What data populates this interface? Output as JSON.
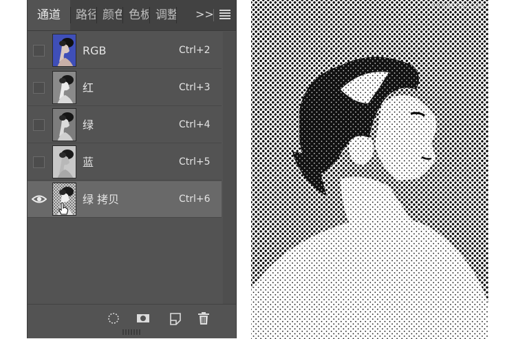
{
  "panel": {
    "tabs": [
      {
        "label": "通道",
        "active": true
      },
      {
        "label": "路径",
        "active": false
      },
      {
        "label": "颜色",
        "active": false
      },
      {
        "label": "色板",
        "active": false
      },
      {
        "label": "调整",
        "active": false
      }
    ],
    "more_glyph": ">>",
    "channels": [
      {
        "name": "RGB",
        "shortcut": "Ctrl+2",
        "visible": false,
        "selected": false,
        "thumb": "rgb"
      },
      {
        "name": "红",
        "shortcut": "Ctrl+3",
        "visible": false,
        "selected": false,
        "thumb": "gray"
      },
      {
        "name": "绿",
        "shortcut": "Ctrl+4",
        "visible": false,
        "selected": false,
        "thumb": "gray"
      },
      {
        "name": "蓝",
        "shortcut": "Ctrl+5",
        "visible": false,
        "selected": false,
        "thumb": "gray"
      },
      {
        "name": "绿 拷贝",
        "shortcut": "Ctrl+6",
        "visible": true,
        "selected": true,
        "thumb": "halftone"
      }
    ],
    "bottom_icons": [
      "selection-icon",
      "mask-icon",
      "new-channel-icon",
      "trash-icon"
    ]
  },
  "artwork": {
    "description_icon": "halftone-portrait-icon",
    "watermark": "www.ps-xxx.com"
  },
  "colors": {
    "panel_bg": "#535353",
    "tab_bg": "#424242",
    "selected_row": "#696969",
    "text": "#e4e4e4"
  }
}
